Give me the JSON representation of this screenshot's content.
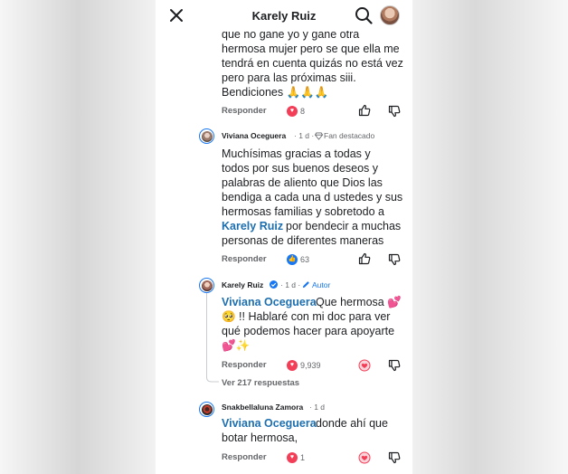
{
  "header": {
    "title": "Karely Ruiz"
  },
  "comment_prev": {
    "lines": [
      "que no gane yo y gane otra",
      "hermosa mujer pero se que ella me",
      "tendrá en cuenta quizás no está vez",
      "pero para las próximas siii.",
      "Bendiciones 🙏🙏🙏"
    ],
    "reply_label": "Responder",
    "reaction_count": "8"
  },
  "comment_viviana": {
    "author": "Viviana Oceguera",
    "time": "· 1 d ·",
    "badge": "Fan destacado",
    "lines": [
      "Muchísimas gracias a todas y",
      "todos por sus buenos deseos y",
      "palabras de aliento que Dios las",
      "bendiga a cada una d ustedes y sus",
      "hermosas familias y sobretodo a",
      "por bendecir a muchas",
      "personas de diferentes maneras"
    ],
    "mention": "Karely Ruiz",
    "reply_label": "Responder",
    "reaction_count": "63"
  },
  "reply_karely": {
    "author": "Karely Ruiz",
    "time": "· 1 d ·",
    "badge": "Autor",
    "mention": "Viviana Oceguera",
    "line1": "Que hermosa 💕",
    "line2": "🥺 !! Hablaré con mi doc para ver",
    "line3": "qué podemos hacer para apoyarte",
    "line4": "💕✨",
    "reply_label": "Responder",
    "reaction_count": "9,939"
  },
  "view_replies": {
    "label": "Ver 217 respuestas"
  },
  "comment_snak": {
    "author": "Snakbellaluna Zamora",
    "time": "· 1 d",
    "mention": "Viviana Oceguera",
    "line1": "donde ahí que",
    "line2": "botar hermosa,",
    "reply_label": "Responder",
    "reaction_count": "1"
  },
  "colors": {
    "mention": "#1d6fb0",
    "heart": "#f33e58",
    "like": "#1877f2"
  },
  "icons": [
    "close-icon",
    "search-icon",
    "thumbs-up-icon",
    "thumbs-down-icon",
    "heart-react-icon",
    "like-react-icon",
    "love-outline-icon",
    "pencil-icon",
    "verified-icon",
    "diamond-icon"
  ]
}
